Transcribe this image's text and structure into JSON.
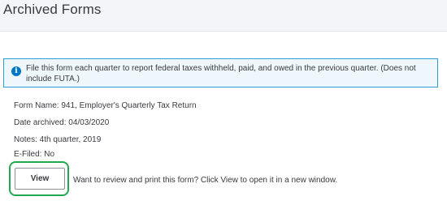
{
  "header": {
    "title": "Archived Forms"
  },
  "notice": {
    "icon": "info-icon",
    "icon_glyph": "i",
    "text": "File this form each quarter to report federal taxes withheld, paid, and owed in the previous quarter. (Does not include FUTA.)"
  },
  "details": {
    "form_name": "Form Name: 941, Employer's Quarterly Tax Return",
    "date_archived": "Date archived: 04/03/2020",
    "notes": "Notes: 4th quarter, 2019",
    "e_filed": "E-Filed: No"
  },
  "actions": {
    "view_label": "View",
    "view_hint": "Want to review and print this form? Click View to open it in a new window."
  },
  "colors": {
    "header_bg": "#f4f5f8",
    "notice_border": "#2c9fd9",
    "notice_bg": "#eef7fc",
    "info_icon": "#0077c5",
    "highlight": "#22a851"
  }
}
